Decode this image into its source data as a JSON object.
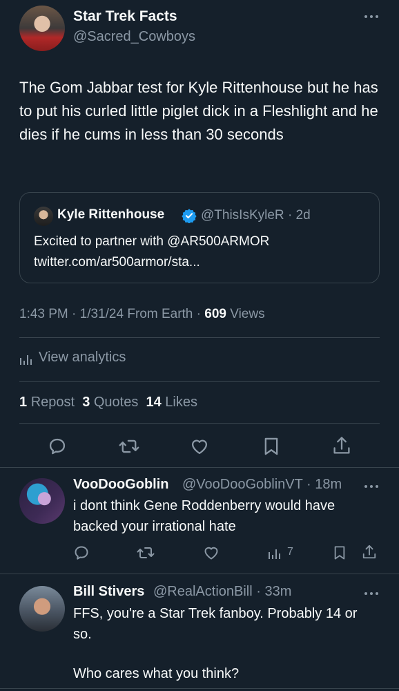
{
  "tweet": {
    "author_name": "Star Trek Facts",
    "author_handle": "@Sacred_Cowboys",
    "text": "The Gom Jabbar test for Kyle Rittenhouse but he has to put his curled little piglet dick in a Fleshlight and he dies if he cums in less than 30 seconds",
    "time": "1:43 PM",
    "date": "1/31/24",
    "source": "From Earth",
    "views_count": "609",
    "views_label": "Views",
    "separator": "·"
  },
  "quote": {
    "author_name": "Kyle Rittenhouse",
    "author_handle": "@ThisIsKyleR",
    "age": "2d",
    "text": "Excited to partner with @AR500ARMOR twitter.com/ar500armor/sta..."
  },
  "analytics": {
    "label": "View analytics"
  },
  "stats": {
    "reposts_count": "1",
    "reposts_label": "Repost",
    "quotes_count": "3",
    "quotes_label": "Quotes",
    "likes_count": "14",
    "likes_label": "Likes"
  },
  "icons": {
    "reply": "reply-icon",
    "repost": "repost-icon",
    "like": "heart-icon",
    "bookmark": "bookmark-icon",
    "share": "share-icon",
    "more": "more-icon",
    "verified": "verified-icon",
    "analytics": "analytics-icon"
  },
  "colors": {
    "background": "#15202b",
    "text": "#f7f9f9",
    "muted": "#8b98a5",
    "divider": "#38444d",
    "verified": "#1d9bf0"
  },
  "replies": [
    {
      "author_name": "VooDooGoblin",
      "author_handle": "@VooDooGoblinVT",
      "age": "18m",
      "text": "i dont think Gene Roddenberry would have backed your irrational hate",
      "views": "7"
    },
    {
      "author_name": "Bill Stivers",
      "author_handle": "@RealActionBill",
      "age": "33m",
      "text_line1": "FFS, you're a Star Trek fanboy. Probably 14 or so.",
      "text_line2": "Who cares what you think?"
    }
  ]
}
